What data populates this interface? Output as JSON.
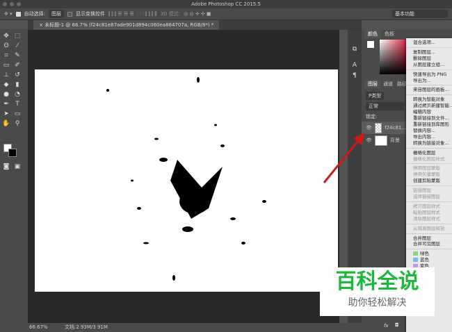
{
  "title": "Adobe Photoshop CC 2015.5",
  "options": {
    "auto_select": "自动选择:",
    "auto_select_value": "图层",
    "show_transform": "显示变换控件",
    "mode3d": "3D 模式:",
    "workspace": "基本功能"
  },
  "tab": {
    "label": "未标题-1 @ 66.7% (f24c81e87ade901d894c060ea864707a, RGB/8*) *"
  },
  "status": {
    "zoom": "66.67%",
    "doc": "文档:2.93M/3.91M"
  },
  "panels": {
    "color_tabs": [
      "颜色",
      "色板"
    ],
    "layer_tabs": [
      "图层",
      "通道",
      "路径"
    ],
    "filter": "P类型",
    "blend": "正常",
    "lock": "锁定:",
    "layers": [
      "f24c81...",
      "背景"
    ],
    "fx": "fx"
  },
  "menu": {
    "items": [
      {
        "label": "混合选项...",
        "disabled": false,
        "sep": true
      },
      {
        "label": "复制图层...",
        "disabled": false
      },
      {
        "label": "删除图层",
        "disabled": false
      },
      {
        "label": "从图层建立组...",
        "disabled": false,
        "sep": true
      },
      {
        "label": "快速导出为 PNG",
        "disabled": false
      },
      {
        "label": "导出为...",
        "disabled": false,
        "sep": true
      },
      {
        "label": "来自图层的画板...",
        "disabled": false,
        "sep": true
      },
      {
        "label": "转换为智能对象",
        "disabled": false
      },
      {
        "label": "通过拷贝新建智能...",
        "disabled": false
      },
      {
        "label": "编辑内容",
        "disabled": false
      },
      {
        "label": "重新链接到文件...",
        "disabled": false
      },
      {
        "label": "重新链接到库图形",
        "disabled": false
      },
      {
        "label": "替换内容...",
        "disabled": false
      },
      {
        "label": "导出内容...",
        "disabled": false
      },
      {
        "label": "转换为链接对象...",
        "disabled": false,
        "sep": true
      },
      {
        "label": "栅格化图层",
        "disabled": false
      },
      {
        "label": "栅格化图层样式",
        "disabled": true,
        "sep": true
      },
      {
        "label": "停用图层蒙版",
        "disabled": true
      },
      {
        "label": "停用矢量蒙版",
        "disabled": true
      },
      {
        "label": "创建剪贴蒙版",
        "disabled": false,
        "sep": true
      },
      {
        "label": "链接图层",
        "disabled": true
      },
      {
        "label": "选择链接图层",
        "disabled": true,
        "sep": true
      },
      {
        "label": "拷贝图层样式",
        "disabled": true
      },
      {
        "label": "粘贴图层样式",
        "disabled": true
      },
      {
        "label": "清除图层样式",
        "disabled": true,
        "sep": true
      },
      {
        "label": "从隔离图层释放",
        "disabled": true,
        "sep": true
      },
      {
        "label": "合并图层",
        "disabled": false
      },
      {
        "label": "合并可见图层",
        "disabled": false
      }
    ],
    "colors": [
      {
        "label": "绿色",
        "color": "#8fd67a"
      },
      {
        "label": "蓝色",
        "color": "#7ab8f0"
      },
      {
        "label": "紫色",
        "color": "#b59ae8"
      }
    ]
  },
  "watermark": {
    "line1": "百科全说",
    "line2": "助你轻松解决"
  }
}
